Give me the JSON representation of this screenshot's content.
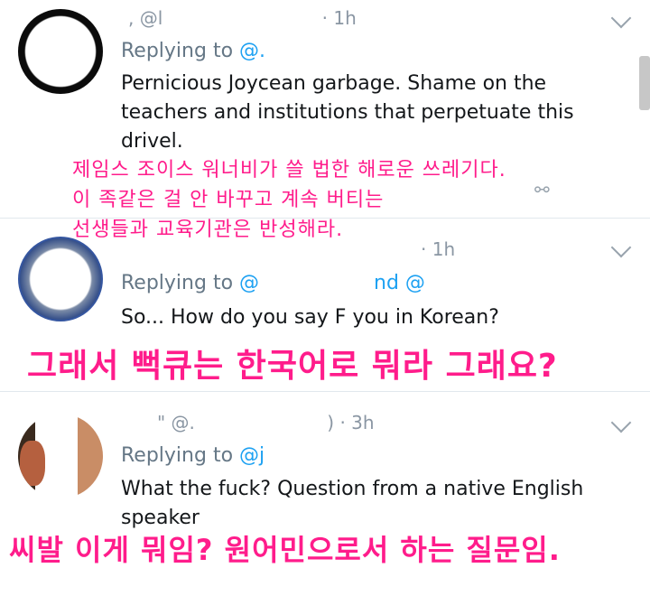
{
  "tweets": [
    {
      "handle_fragment": ", @l",
      "time": "· 1h",
      "replying_label": "Replying to",
      "replying_at": "@.",
      "body": "Pernicious Joycean garbage.  Shame on the teachers and institutions that perpetuate this drivel.",
      "korean": [
        "제임스 조이스 워너비가 쓸 법한 해로운 쓰레기다.",
        "이 족같은 걸 안 바꾸고 계속 버티는",
        "선생들과 교육기관은 반성해라."
      ]
    },
    {
      "handle_fragment": "",
      "time": "· 1h",
      "replying_label": "Replying to",
      "replying_at": "@",
      "replying_tail": "nd @",
      "body": "So... How do you say F you in Korean?",
      "korean": "그래서 뻑큐는 한국어로 뭐라 그래요?"
    },
    {
      "handle_fragment": "\" @.",
      "time": ") · 3h",
      "replying_label": "Replying to",
      "replying_at": "@j",
      "body": "What the fuck? Question from a native English speaker",
      "korean": "씨발 이게 뭐임? 원어민으로서 하는 질문임."
    }
  ],
  "icons": {
    "menu": "chevron-down-icon",
    "share": "link-icon"
  }
}
